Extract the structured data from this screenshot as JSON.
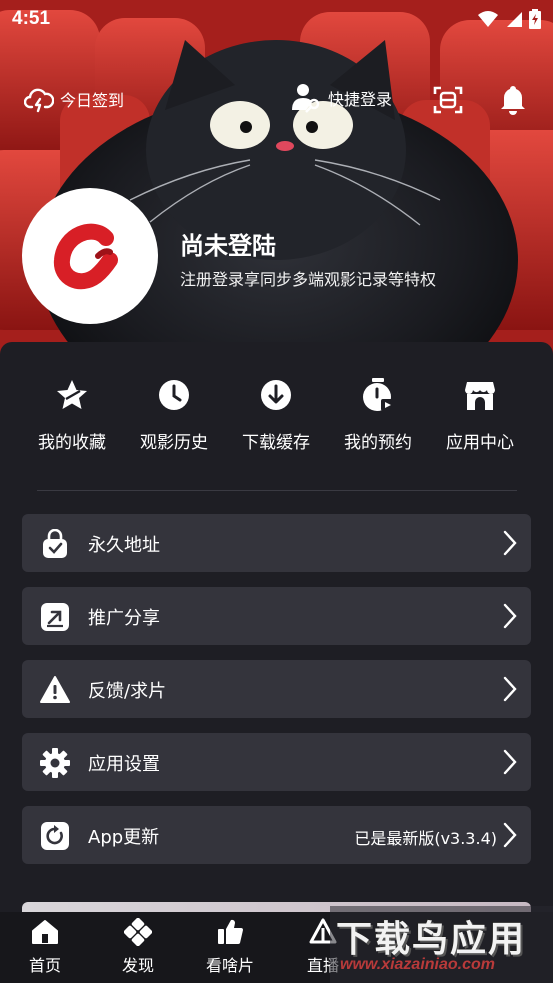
{
  "status_bar": {
    "time": "4:51",
    "icons": [
      "wifi-icon",
      "signal-icon",
      "battery-icon"
    ]
  },
  "top_bar": {
    "checkin_label": "今日签到",
    "quick_login_label": "快捷登录",
    "icons": [
      "cloud-lightning-icon",
      "user-key-icon",
      "scan-icon",
      "bell-icon"
    ]
  },
  "profile": {
    "name": "尚未登陆",
    "subtitle": "注册登录享同步多端观影记录等特权"
  },
  "quick_actions": [
    {
      "label": "我的收藏",
      "icon": "star-icon"
    },
    {
      "label": "观影历史",
      "icon": "clock-icon"
    },
    {
      "label": "下载缓存",
      "icon": "download-icon"
    },
    {
      "label": "我的预约",
      "icon": "timer-icon"
    },
    {
      "label": "应用中心",
      "icon": "app-store-icon"
    }
  ],
  "menu": [
    {
      "label": "永久地址",
      "value": "",
      "icon": "lock-bag-icon"
    },
    {
      "label": "推广分享",
      "value": "",
      "icon": "share-icon"
    },
    {
      "label": "反馈/求片",
      "value": "",
      "icon": "warning-icon"
    },
    {
      "label": "应用设置",
      "value": "",
      "icon": "gear-icon"
    },
    {
      "label": "App更新",
      "value": "已是最新版(v3.3.4)",
      "icon": "refresh-icon"
    }
  ],
  "bottom_nav": [
    {
      "label": "首页",
      "icon": "home-icon"
    },
    {
      "label": "发现",
      "icon": "discover-icon"
    },
    {
      "label": "看啥片",
      "icon": "thumbs-up-icon"
    },
    {
      "label": "直播",
      "icon": "live-icon"
    }
  ],
  "watermark": {
    "title": "下载鸟应用",
    "url": "www.xiazainiao.com"
  },
  "colors": {
    "panel_bg": "#1e1e24",
    "menu_item_bg": "#34343c",
    "hero_red": "#c62828",
    "avatar_logo_red": "#d81f26"
  }
}
